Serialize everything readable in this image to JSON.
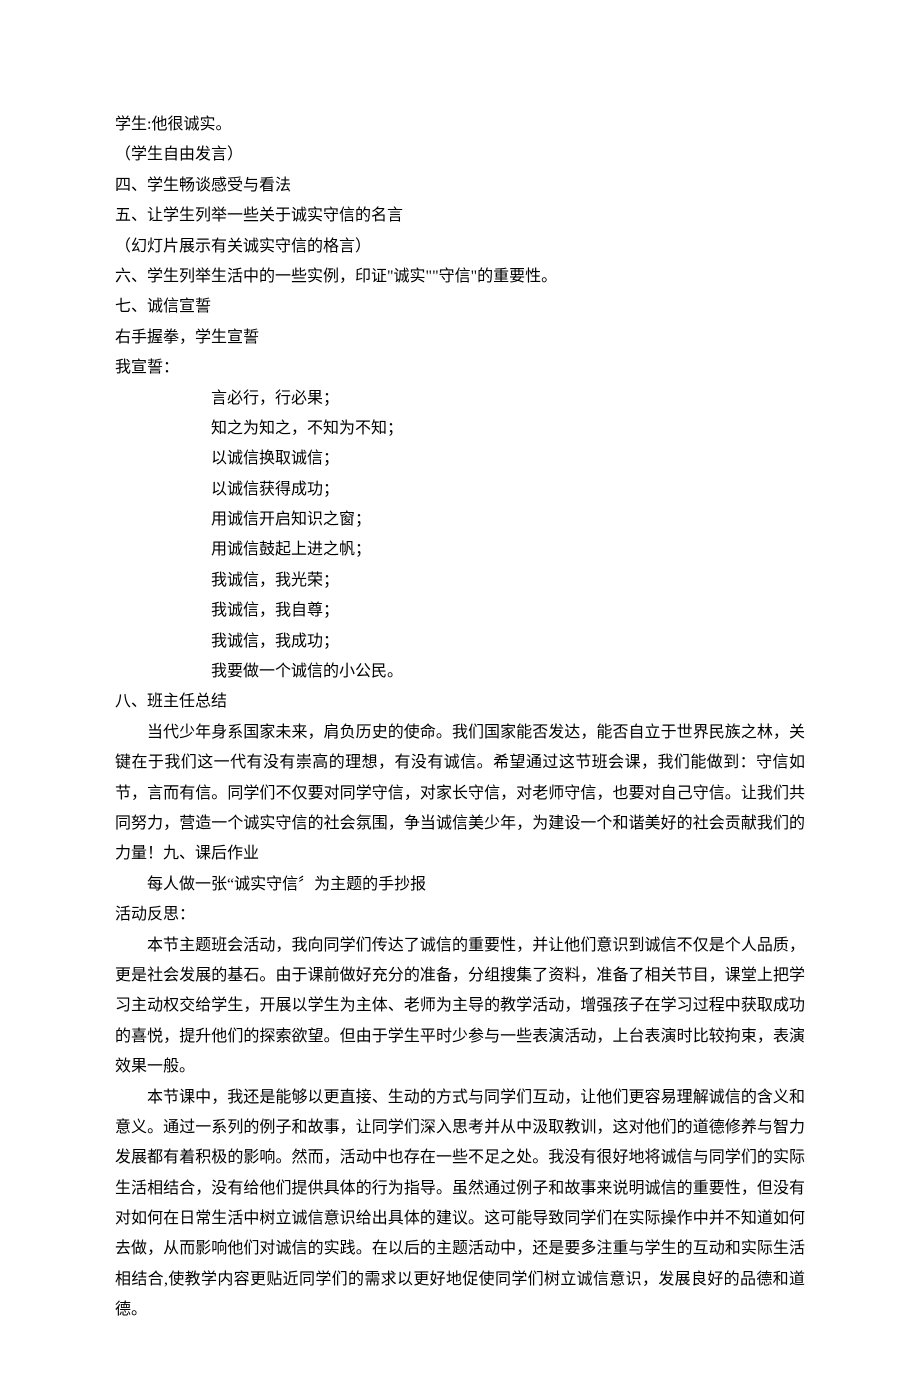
{
  "lines": [
    {
      "cls": "line",
      "text": "学生:他很诚实。"
    },
    {
      "cls": "line",
      "text": "（学生自由发言）"
    },
    {
      "cls": "line",
      "text": "四、学生畅谈感受与看法"
    },
    {
      "cls": "line",
      "text": "五、让学生列举一些关于诚实守信的名言"
    },
    {
      "cls": "line",
      "text": "（幻灯片展示有关诚实守信的格言）"
    },
    {
      "cls": "line",
      "text": "六、学生列举生活中的一些实例，印证\"诚实\"\"守信\"的重要性。"
    },
    {
      "cls": "line",
      "text": "七、诚信宣誓"
    },
    {
      "cls": "line",
      "text": "右手握拳，学生宣誓"
    },
    {
      "cls": "line",
      "text": "我宣誓："
    },
    {
      "cls": "line indent-large",
      "text": "言必行，行必果；"
    },
    {
      "cls": "line indent-large",
      "text": "知之为知之，不知为不知；"
    },
    {
      "cls": "line indent-large",
      "text": "以诚信换取诚信；"
    },
    {
      "cls": "line indent-large",
      "text": "以诚信获得成功；"
    },
    {
      "cls": "line indent-large",
      "text": "用诚信开启知识之窗；"
    },
    {
      "cls": "line indent-large",
      "text": "用诚信鼓起上进之帆；"
    },
    {
      "cls": "line indent-large",
      "text": "我诚信，我光荣；"
    },
    {
      "cls": "line indent-large",
      "text": "我诚信，我自尊；"
    },
    {
      "cls": "line indent-large",
      "text": "我诚信，我成功；"
    },
    {
      "cls": "line indent-large",
      "text": "我要做一个诚信的小公民。"
    },
    {
      "cls": "line",
      "text": "八、班主任总结"
    },
    {
      "cls": "line indent justify",
      "text": "当代少年身系国家未来，肩负历史的使命。我们国家能否发达，能否自立于世界民族之林，关键在于我们这一代有没有崇高的理想，有没有诚信。希望通过这节班会课，我们能做到：守信如节，言而有信。同学们不仅要对同学守信，对家长守信，对老师守信，也要对自己守信。让我们共同努力，营造一个诚实守信的社会氛围，争当诚信美少年，为建设一个和谐美好的社会贡献我们的力量！九、课后作业"
    },
    {
      "cls": "line indent",
      "text": "每人做一张“诚实守信〞为主题的手抄报"
    },
    {
      "cls": "line",
      "text": "活动反思："
    },
    {
      "cls": "line indent justify",
      "text": "本节主题班会活动，我向同学们传达了诚信的重要性，并让他们意识到诚信不仅是个人品质，更是社会发展的基石。由于课前做好充分的准备，分组搜集了资料，准备了相关节目，课堂上把学习主动权交给学生，开展以学生为主体、老师为主导的教学活动，增强孩子在学习过程中获取成功的喜悦，提升他们的探索欲望。但由于学生平时少参与一些表演活动，上台表演时比较拘束，表演效果一般。"
    },
    {
      "cls": "line indent justify",
      "text": "本节课中，我还是能够以更直接、生动的方式与同学们互动，让他们更容易理解诚信的含义和意义。通过一系列的例子和故事，让同学们深入思考并从中汲取教训，这对他们的道德修养与智力发展都有着积极的影响。然而，活动中也存在一些不足之处。我没有很好地将诚信与同学们的实际生活相结合，没有给他们提供具体的行为指导。虽然通过例子和故事来说明诚信的重要性，但没有对如何在日常生活中树立诚信意识给出具体的建议。这可能导致同学们在实际操作中并不知道如何去做，从而影响他们对诚信的实践。在以后的主题活动中，还是要多注重与学生的互动和实际生活相结合,使教学内容更贴近同学们的需求以更好地促使同学们树立诚信意识，发展良好的品德和道德。"
    }
  ]
}
